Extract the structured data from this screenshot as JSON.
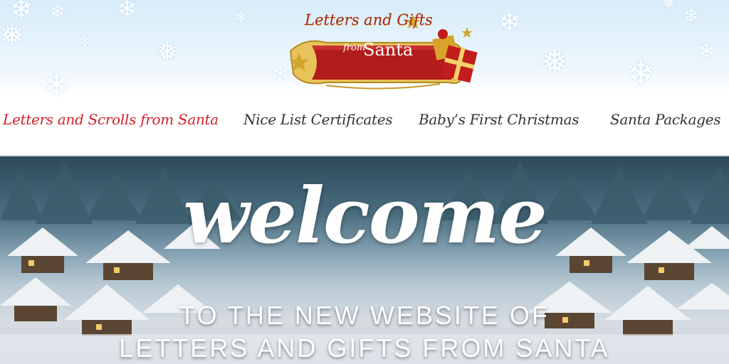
{
  "header": {
    "logo": {
      "line1": "Letters and Gifts",
      "line2_from": "from",
      "line2_name": "Santa"
    },
    "colors": {
      "accent": "#d0202a",
      "ribbon": "#b11c1c",
      "gold": "#d4a52c"
    }
  },
  "nav": {
    "items": [
      {
        "label": "Letters and Scrolls from Santa",
        "active": true
      },
      {
        "label": "Nice List Certificates",
        "active": false
      },
      {
        "label": "Baby’s First Christmas",
        "active": false
      },
      {
        "label": "Santa Packages",
        "active": false
      }
    ]
  },
  "hero": {
    "title": "welcome",
    "subtitle_line1": "TO THE NEW WEBSITE OF",
    "subtitle_line2": "LETTERS AND GIFTS FROM SANTA"
  },
  "icons": [
    "snowflake-icon",
    "gift-icon",
    "star-ornament-icon"
  ]
}
